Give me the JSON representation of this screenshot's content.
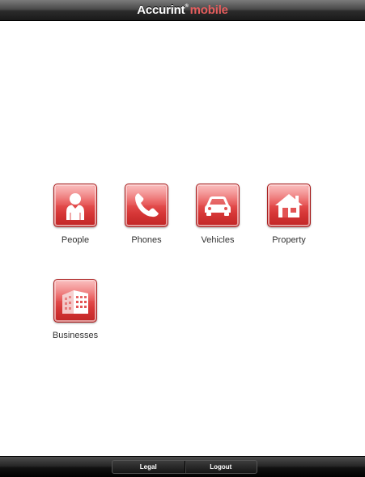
{
  "header": {
    "brand_main": "Accurint",
    "brand_reg": "®",
    "brand_sub": "mobile"
  },
  "tiles": [
    {
      "label": "People",
      "icon": "person-icon"
    },
    {
      "label": "Phones",
      "icon": "phone-icon"
    },
    {
      "label": "Vehicles",
      "icon": "car-icon"
    },
    {
      "label": "Property",
      "icon": "house-icon"
    },
    {
      "label": "Businesses",
      "icon": "building-icon"
    }
  ],
  "footer": {
    "legal_label": "Legal",
    "logout_label": "Logout"
  },
  "colors": {
    "accent": "#e03c3c",
    "brand_sub": "#e45d5d"
  }
}
